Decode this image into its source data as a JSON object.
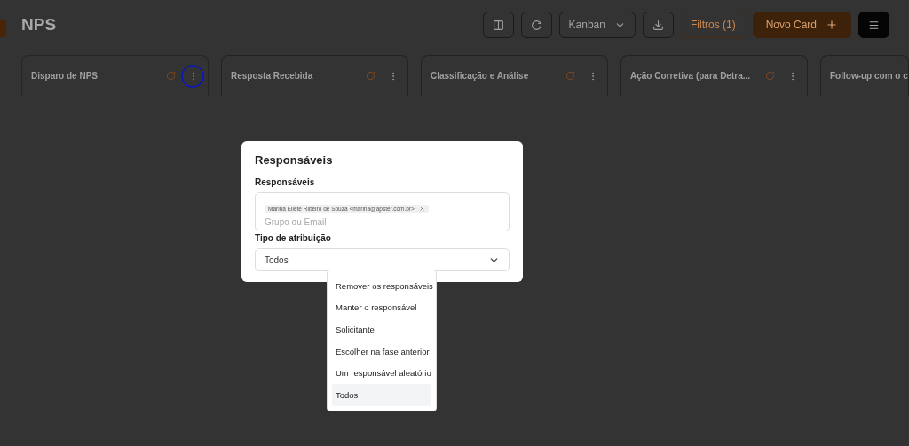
{
  "page": {
    "title": "NPS"
  },
  "toolbar": {
    "view_select": "Kanban",
    "filters_button": "Filtros (1)",
    "new_card_button": "Novo Card"
  },
  "columns": [
    {
      "title": "Disparo de NPS",
      "highlighted": true
    },
    {
      "title": "Resposta Recebida",
      "highlighted": false
    },
    {
      "title": "Classificação e Análise",
      "highlighted": false
    },
    {
      "title": "Ação Corretiva (para Detra...",
      "highlighted": false
    },
    {
      "title": "Follow-up com o c",
      "highlighted": false
    }
  ],
  "modal": {
    "title": "Responsáveis",
    "responsaveis_label": "Responsáveis",
    "chips": [
      "Marina Eliete Ribeiro de Souza <marina@apster.com.br>"
    ],
    "placeholder": "Grupo ou Email",
    "tipo_label": "Tipo de atribuição",
    "tipo_value": "Todos"
  },
  "options": [
    {
      "label": "Remover os responsáveis",
      "selected": false
    },
    {
      "label": "Manter o responsável",
      "selected": false
    },
    {
      "label": "Solicitante",
      "selected": false
    },
    {
      "label": "Escolher na fase anterior",
      "selected": false
    },
    {
      "label": "Um responsável aleatório",
      "selected": false
    },
    {
      "label": "Todos",
      "selected": true
    }
  ]
}
